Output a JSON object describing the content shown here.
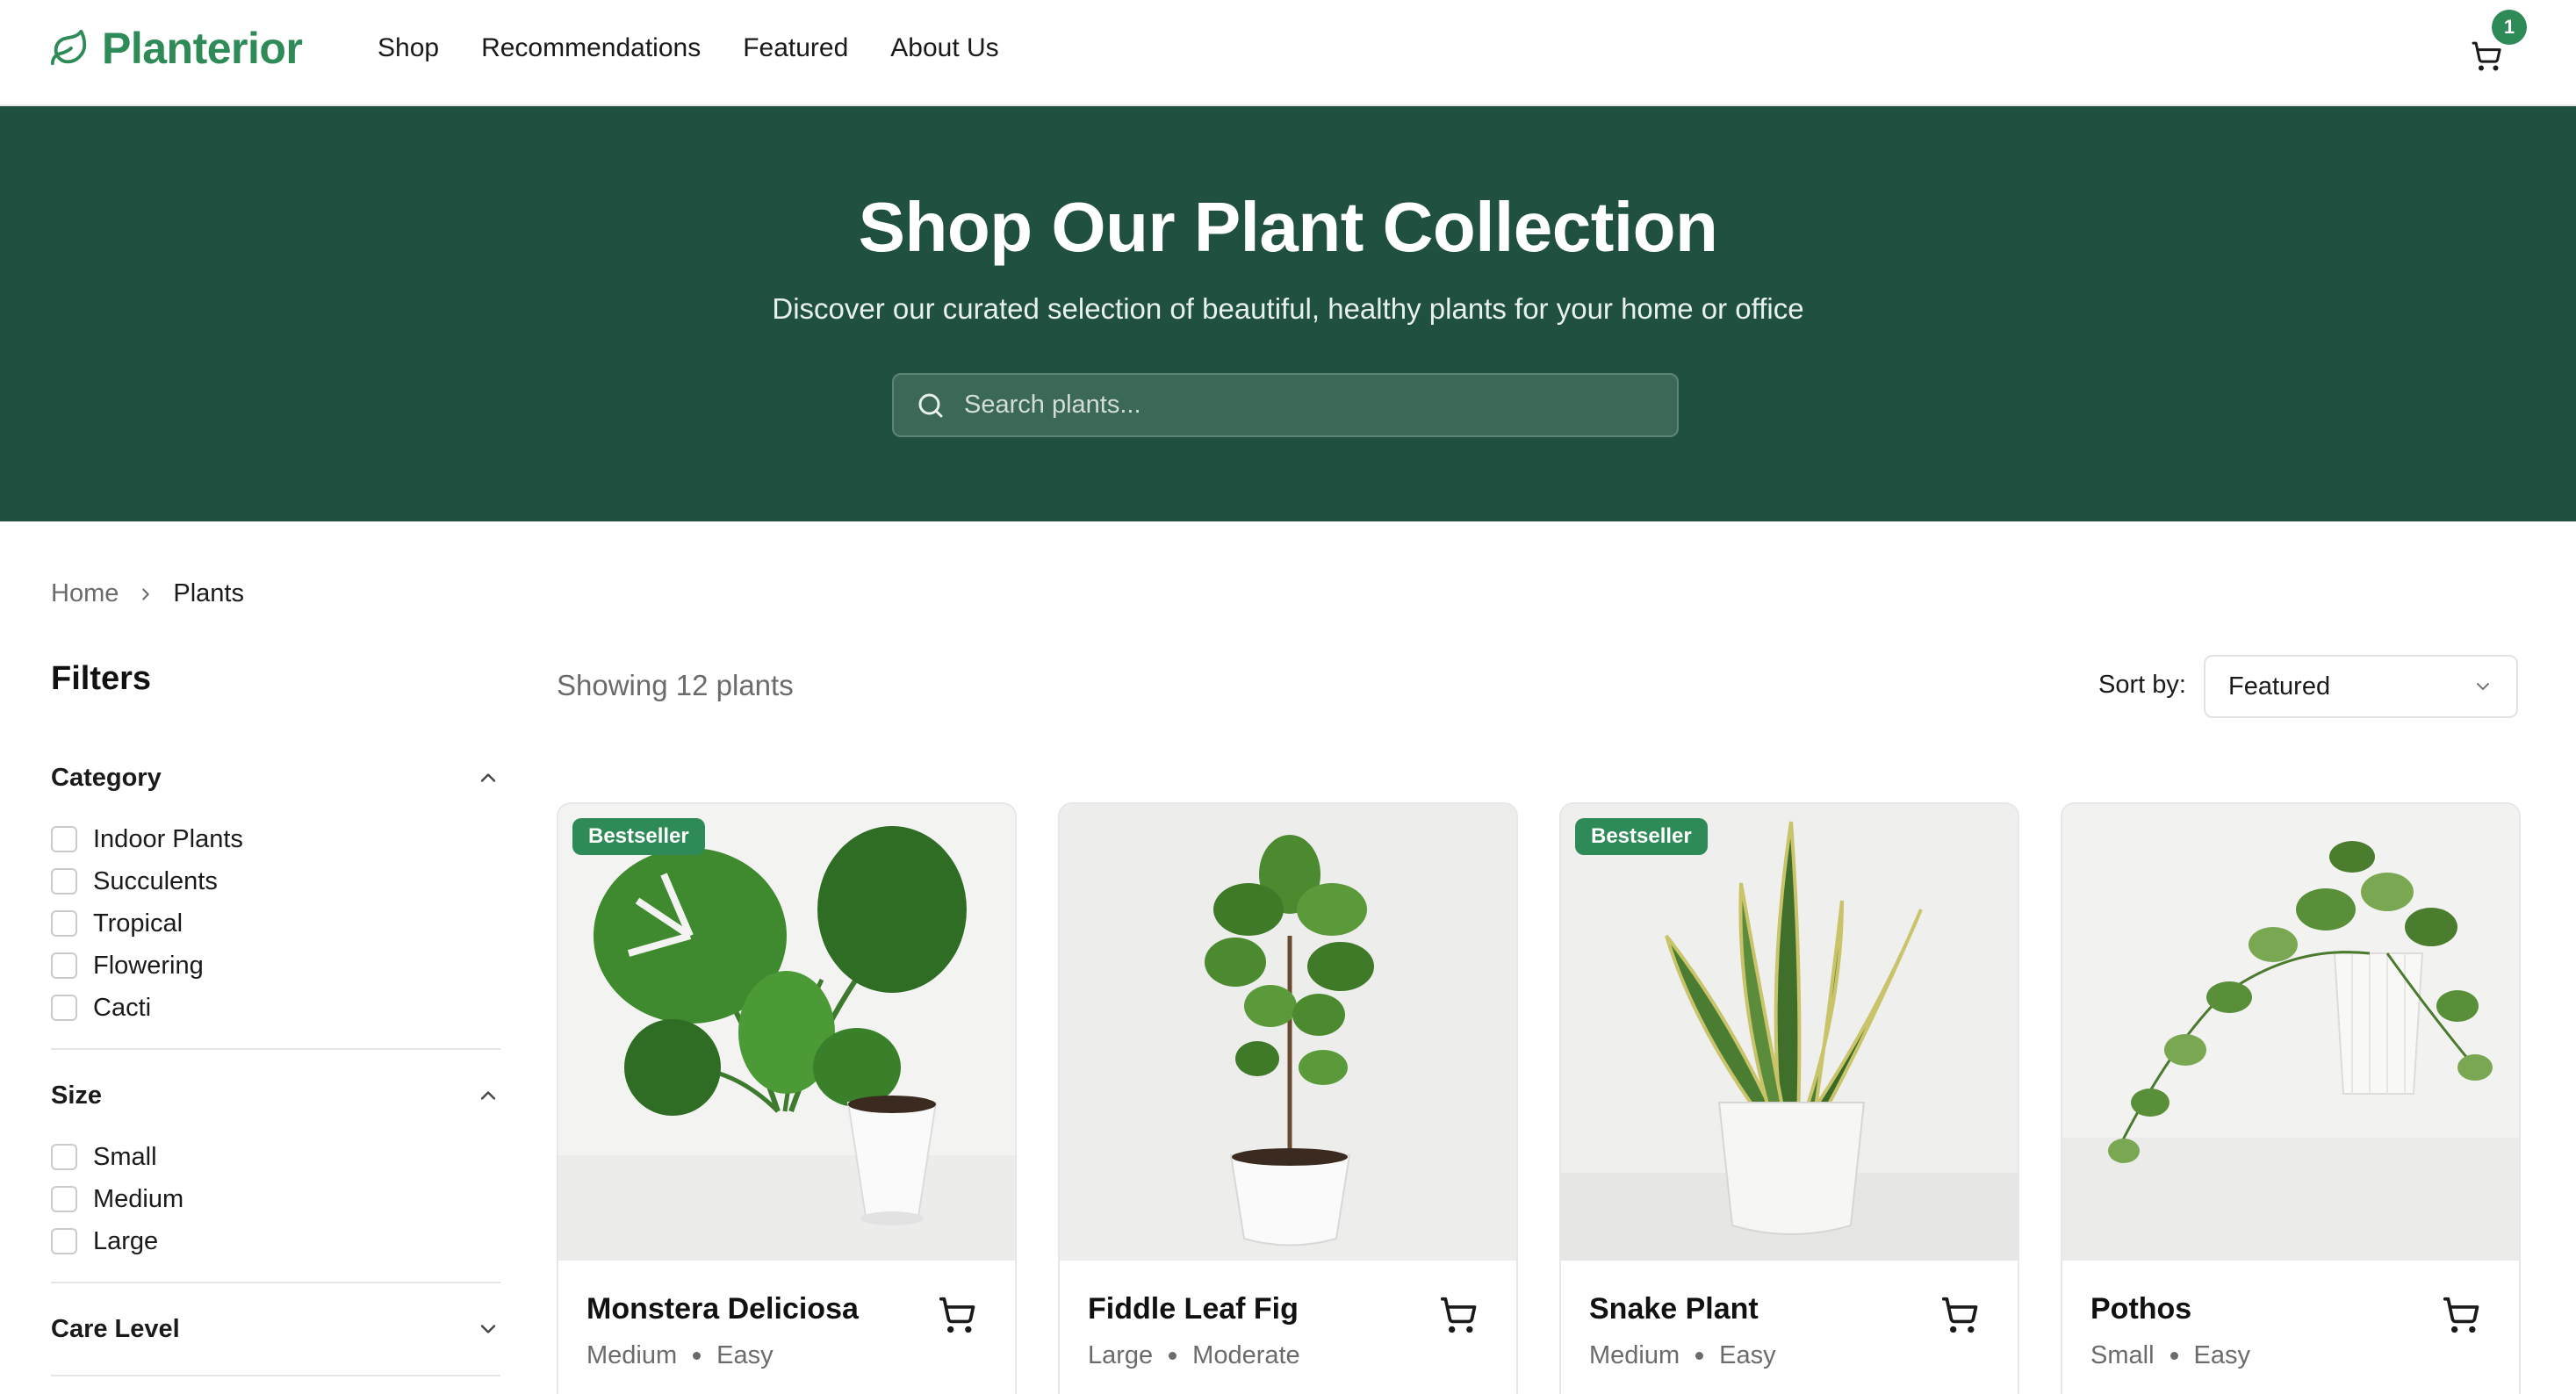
{
  "brand": {
    "name": "Planterior",
    "accent": "#2e8b57",
    "hero_bg": "#1f5040"
  },
  "nav": {
    "items": [
      "Shop",
      "Recommendations",
      "Featured",
      "About Us"
    ]
  },
  "cart": {
    "icon": "cart-icon",
    "count": "1"
  },
  "hero": {
    "title": "Shop Our Plant Collection",
    "subtitle": "Discover our curated selection of beautiful, healthy plants for your home or office",
    "search_placeholder": "Search plants..."
  },
  "breadcrumb": {
    "home": "Home",
    "current": "Plants"
  },
  "filters": {
    "title": "Filters",
    "groups": [
      {
        "label": "Category",
        "expanded": true,
        "options": [
          "Indoor Plants",
          "Succulents",
          "Tropical",
          "Flowering",
          "Cacti"
        ]
      },
      {
        "label": "Size",
        "expanded": true,
        "options": [
          "Small",
          "Medium",
          "Large"
        ]
      },
      {
        "label": "Care Level",
        "expanded": false,
        "options": []
      }
    ]
  },
  "results": {
    "showing": "Showing 12 plants",
    "sort_label": "Sort by:",
    "sort_value": "Featured"
  },
  "products": [
    {
      "name": "Monstera Deliciosa",
      "size": "Medium",
      "care": "Easy",
      "badge": "Bestseller"
    },
    {
      "name": "Fiddle Leaf Fig",
      "size": "Large",
      "care": "Moderate",
      "badge": ""
    },
    {
      "name": "Snake Plant",
      "size": "Medium",
      "care": "Easy",
      "badge": "Bestseller"
    },
    {
      "name": "Pothos",
      "size": "Small",
      "care": "Easy",
      "badge": ""
    }
  ]
}
